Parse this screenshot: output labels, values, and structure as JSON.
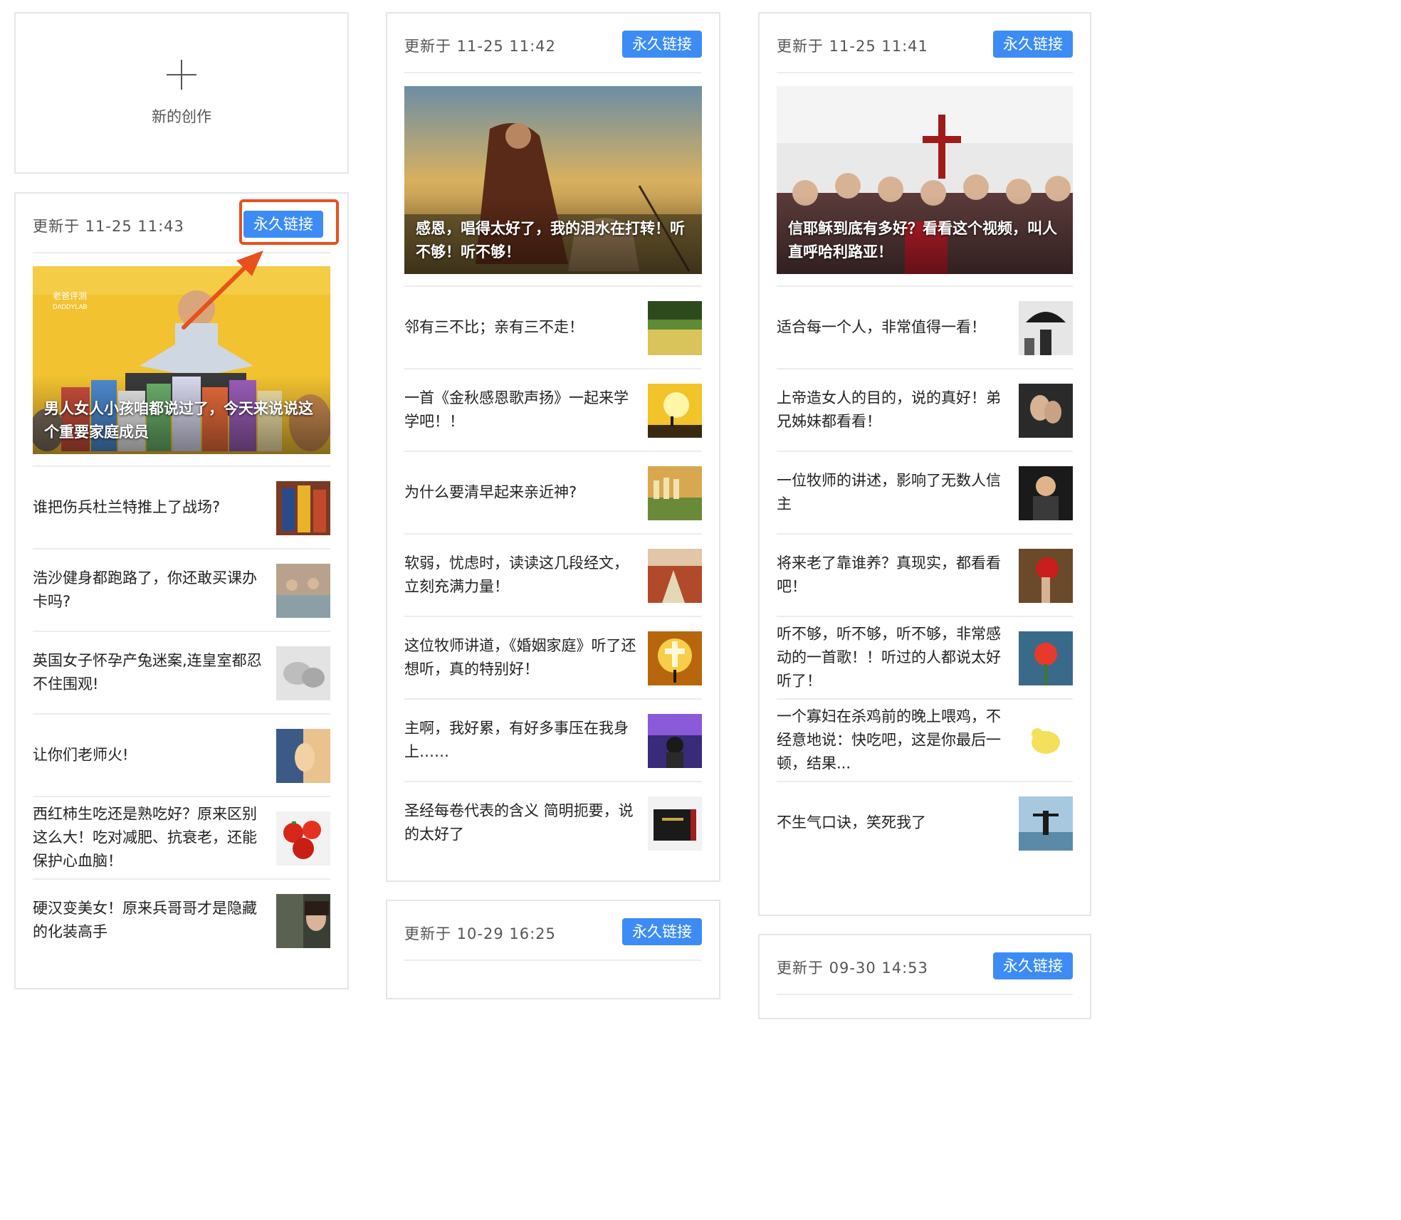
{
  "new_card": {
    "label": "新的创作"
  },
  "permalink_label": "永久链接",
  "colors": {
    "accent": "#3d8cf5",
    "highlight": "#e8501c",
    "border": "#e6e6e6"
  },
  "cards": [
    {
      "updated": "更新于 11-25 11:43",
      "cover_title": "男人女人小孩咱都说过了，今天来说说这个重要家庭成员",
      "items": [
        {
          "title": "谁把伤兵杜兰特推上了战场?"
        },
        {
          "title": "浩沙健身都跑路了，你还敢买课办卡吗?"
        },
        {
          "title": "英国女子怀孕产兔迷案,连皇室都忍不住围观!"
        },
        {
          "title": "让你们老师火!"
        },
        {
          "title": "西红柿生吃还是熟吃好？原来区别这么大！吃对减肥、抗衰老，还能保护心血脑！"
        },
        {
          "title": "硬汉变美女！原来兵哥哥才是隐藏的化装高手"
        }
      ]
    },
    {
      "updated": "更新于 11-25 11:42",
      "cover_title": "感恩，唱得太好了，我的泪水在打转！听不够！听不够！",
      "items": [
        {
          "title": "邻有三不比；亲有三不走！"
        },
        {
          "title": "一首《金秋感恩歌声扬》一起来学学吧！！"
        },
        {
          "title": "为什么要清早起来亲近神?"
        },
        {
          "title": "软弱，忧虑时，读读这几段经文，立刻充满力量！"
        },
        {
          "title": "这位牧师讲道，《婚姻家庭》听了还想听，真的特别好！"
        },
        {
          "title": "主啊，我好累，有好多事压在我身上……"
        },
        {
          "title": "圣经每卷代表的含义 简明扼要，说的太好了"
        }
      ]
    },
    {
      "updated": "更新于 11-25 11:41",
      "cover_title": "信耶稣到底有多好？看看这个视频，叫人直呼哈利路亚！",
      "items": [
        {
          "title": "适合每一个人，非常值得一看！"
        },
        {
          "title": "上帝造女人的目的，说的真好！弟兄姊妹都看看！"
        },
        {
          "title": "一位牧师的讲述，影响了无数人信主"
        },
        {
          "title": "将来老了靠谁养？真现实，都看看吧！"
        },
        {
          "title": "听不够，听不够，听不够，非常感动的一首歌！！听过的人都说太好听了！"
        },
        {
          "title": "一个寡妇在杀鸡前的晚上喂鸡，不经意地说：快吃吧，这是你最后一顿，结果..."
        },
        {
          "title": "不生气口诀，笑死我了"
        }
      ]
    },
    {
      "updated": "更新于 10-29 16:25"
    },
    {
      "updated": "更新于 09-30 14:53"
    }
  ]
}
